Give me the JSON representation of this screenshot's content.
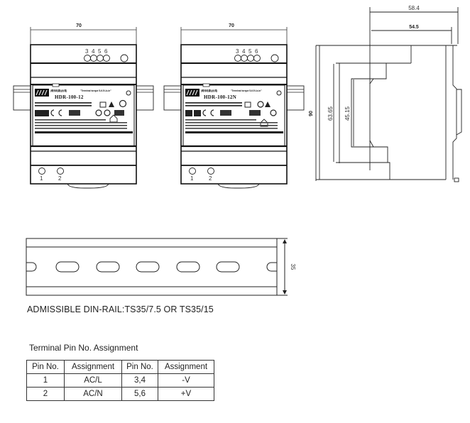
{
  "front_views": [
    {
      "model_label": "HDR-100-12",
      "width_dim": "70",
      "output_pins": [
        "3",
        "4",
        "5",
        "6"
      ],
      "input_pins": [
        "1",
        "2"
      ]
    },
    {
      "model_label": "HDR-100-12N",
      "width_dim": "70",
      "output_pins": [
        "3",
        "4",
        "5",
        "6"
      ],
      "input_pins": [
        "1",
        "2"
      ]
    }
  ],
  "side_view": {
    "depth_total": "58.4",
    "depth_body": "54.5",
    "height_total": "90",
    "height_step": "63.65",
    "height_inner": "45.15"
  },
  "din_rail": {
    "height_dim": "35",
    "caption": "ADMISSIBLE DIN-RAIL:TS35/7.5 OR TS35/15"
  },
  "pin_table": {
    "title": "Terminal Pin No.  Assignment",
    "headers": [
      "Pin No.",
      "Assignment",
      "Pin No.",
      "Assignment"
    ],
    "rows": [
      [
        "1",
        "AC/L",
        "3,4",
        "-V"
      ],
      [
        "2",
        "AC/N",
        "5,6",
        "+V"
      ]
    ]
  }
}
